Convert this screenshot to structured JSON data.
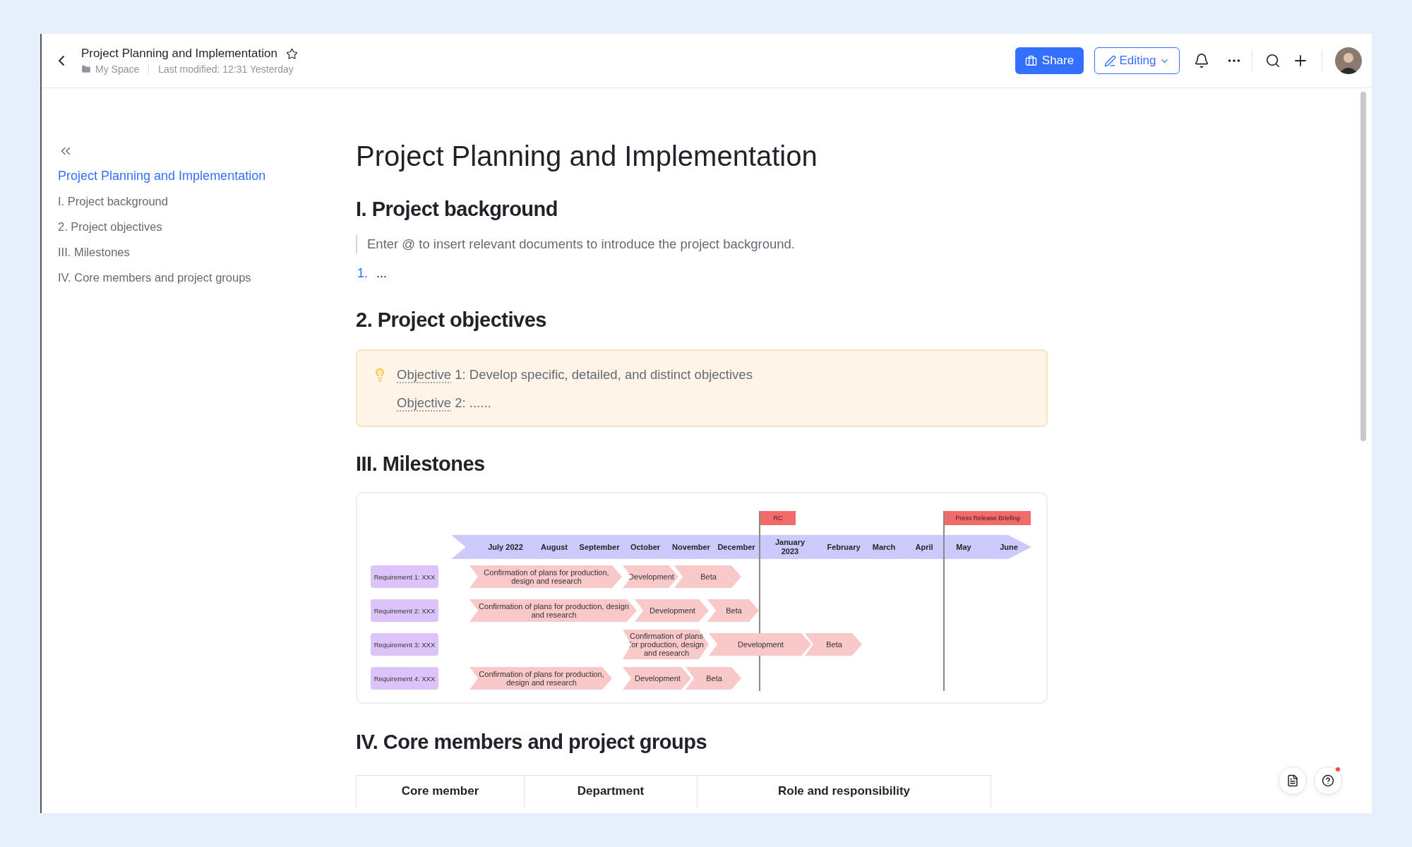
{
  "header": {
    "title": "Project Planning and Implementation",
    "space": "My Space",
    "modified": "Last modified: 12:31 Yesterday",
    "share_button": "Share",
    "mode_button": "Editing"
  },
  "outline": [
    {
      "label": "Project Planning and Implementation",
      "selected": true
    },
    {
      "label": "I. Project background",
      "selected": false
    },
    {
      "label": "2. Project objectives",
      "selected": false
    },
    {
      "label": "III. Milestones",
      "selected": false
    },
    {
      "label": "IV. Core members and project groups",
      "selected": false
    }
  ],
  "document": {
    "title": "Project Planning and Implementation",
    "background": {
      "heading": "I. Project background",
      "quote": "Enter @ to insert relevant documents to introduce the project background.",
      "list": [
        {
          "number": "1.",
          "text": "..."
        }
      ]
    },
    "objectives": {
      "heading": "2. Project objectives",
      "items": [
        {
          "term": "Objective",
          "rest": " 1: Develop specific, detailed, and distinct objectives"
        },
        {
          "term": "Objective",
          "rest": " 2: ......"
        }
      ]
    },
    "milestones": {
      "heading": "III. Milestones",
      "months": [
        "July 2022",
        "August",
        "September",
        "October",
        "November",
        "December",
        "January 2023",
        "February",
        "March",
        "April",
        "May",
        "June"
      ],
      "flags": [
        {
          "label": "RC"
        },
        {
          "label": "Press Release Briefing"
        }
      ],
      "rows": [
        {
          "label": "Requirement 1: XXX",
          "phases": [
            "Confirmation of plans for production, design and research",
            "Development",
            "Beta"
          ]
        },
        {
          "label": "Requirement 2: XXX",
          "phases": [
            "Confirmation of plans for production, design and research",
            "Development",
            "Beta"
          ]
        },
        {
          "label": "Requirement 3: XXX",
          "phases": [
            "Confirmation of plans for production, design and research",
            "Development",
            "Beta"
          ]
        },
        {
          "label": "Requirement 4: XXX",
          "phases": [
            "Confirmation of plans for production, design and research",
            "Development",
            "Beta"
          ]
        }
      ]
    },
    "members": {
      "heading": "IV. Core members and project groups",
      "columns": [
        "Core member",
        "Department",
        "Role and responsibility"
      ]
    }
  }
}
